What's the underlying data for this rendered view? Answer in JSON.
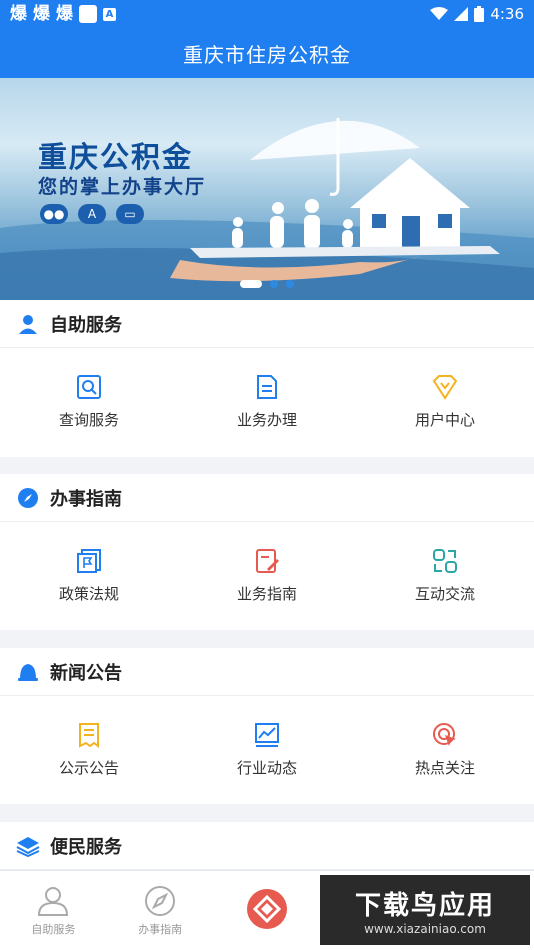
{
  "status_bar": {
    "glyphs": [
      "爆",
      "爆",
      "爆"
    ],
    "a_badge": "A",
    "time": "4:36"
  },
  "header": {
    "title": "重庆市住房公积金"
  },
  "banner": {
    "title": "重庆公积金",
    "subtitle": "您的掌上办事大厅",
    "icons": [
      "wechat-icon",
      "app-store-icon",
      "laptop-icon"
    ],
    "slide_count": 3,
    "active_slide": 1
  },
  "sections": [
    {
      "title": "自助服务",
      "icon": "person-icon",
      "items": [
        {
          "label": "查询服务",
          "icon": "search-icon"
        },
        {
          "label": "业务办理",
          "icon": "document-icon"
        },
        {
          "label": "用户中心",
          "icon": "user-center-icon"
        }
      ]
    },
    {
      "title": "办事指南",
      "icon": "compass-icon",
      "items": [
        {
          "label": "政策法规",
          "icon": "flag-doc-icon"
        },
        {
          "label": "业务指南",
          "icon": "edit-doc-icon"
        },
        {
          "label": "互动交流",
          "icon": "chat-icon"
        }
      ]
    },
    {
      "title": "新闻公告",
      "icon": "bell-icon",
      "items": [
        {
          "label": "公示公告",
          "icon": "notice-icon"
        },
        {
          "label": "行业动态",
          "icon": "trend-icon"
        },
        {
          "label": "热点关注",
          "icon": "target-icon"
        }
      ]
    },
    {
      "title": "便民服务",
      "icon": "layers-icon",
      "items": []
    }
  ],
  "bottom_nav": [
    {
      "label": "自助服务",
      "icon": "person-outline-icon"
    },
    {
      "label": "办事指南",
      "icon": "compass-outline-icon"
    },
    {
      "label": "",
      "icon": "home-logo-icon"
    }
  ],
  "watermark": {
    "title": "下载鸟应用",
    "url": "www.xiazainiao.com"
  },
  "colors": {
    "primary": "#1f7ff0",
    "accent_yellow": "#f3b321",
    "accent_red": "#e65a4f",
    "accent_teal": "#2ba6a6"
  }
}
